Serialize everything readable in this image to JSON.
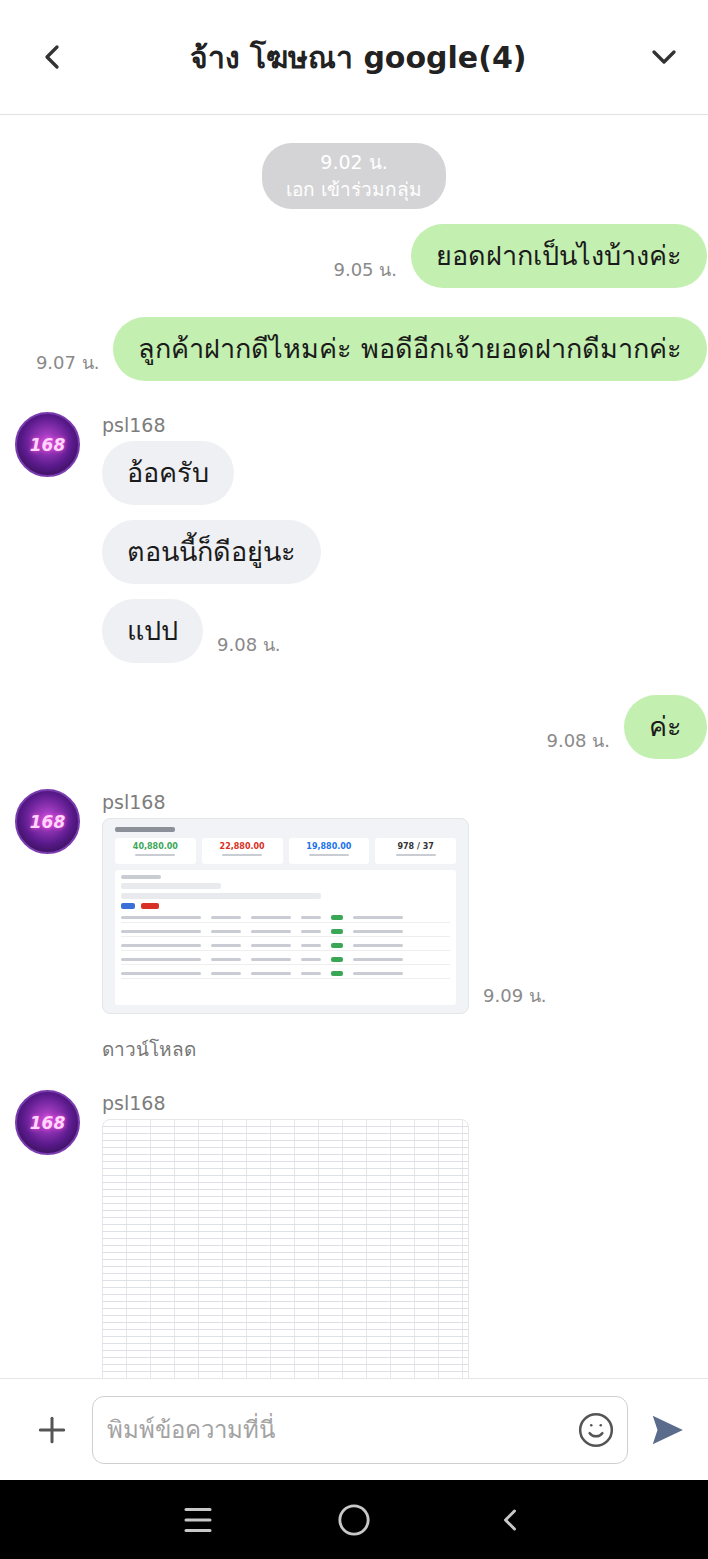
{
  "header": {
    "title": "จ้าง โฆษณา google(4)"
  },
  "messages": [
    {
      "kind": "system",
      "time": "9.02 น.",
      "text": "เอก เข้าร่วมกลุ่ม"
    },
    {
      "kind": "sent",
      "text": "ยอดฝากเป็นไงบ้างค่ะ",
      "time": "9.05 น."
    },
    {
      "kind": "sent",
      "text": "ลูกค้าฝากดีไหมค่ะ  พอดีอีกเจ้ายอดฝากดีมากค่ะ",
      "time": "9.07 น."
    },
    {
      "kind": "received",
      "sender": "psl168",
      "avatar": "168",
      "bubbles": [
        "อ้อครับ",
        "ตอนนี้ก็ดีอยู่นะ",
        "แปป"
      ],
      "time": "9.08 น."
    },
    {
      "kind": "sent",
      "text": "ค่ะ",
      "time": "9.08 น."
    },
    {
      "kind": "dashboard",
      "sender": "psl168",
      "avatar": "168",
      "time": "9.09 น.",
      "caption": "ดาวน์โหลด",
      "cards": [
        {
          "value": "40,880.00",
          "color": "#3aa757"
        },
        {
          "value": "22,880.00",
          "color": "#d93025"
        },
        {
          "value": "19,880.00",
          "color": "#1a73e8"
        },
        {
          "value": "978 / 37",
          "color": "#333333"
        }
      ]
    },
    {
      "kind": "sheet",
      "sender": "psl168",
      "avatar": "168"
    }
  ],
  "input": {
    "placeholder": "พิมพ์ข้อความที่นี่"
  }
}
